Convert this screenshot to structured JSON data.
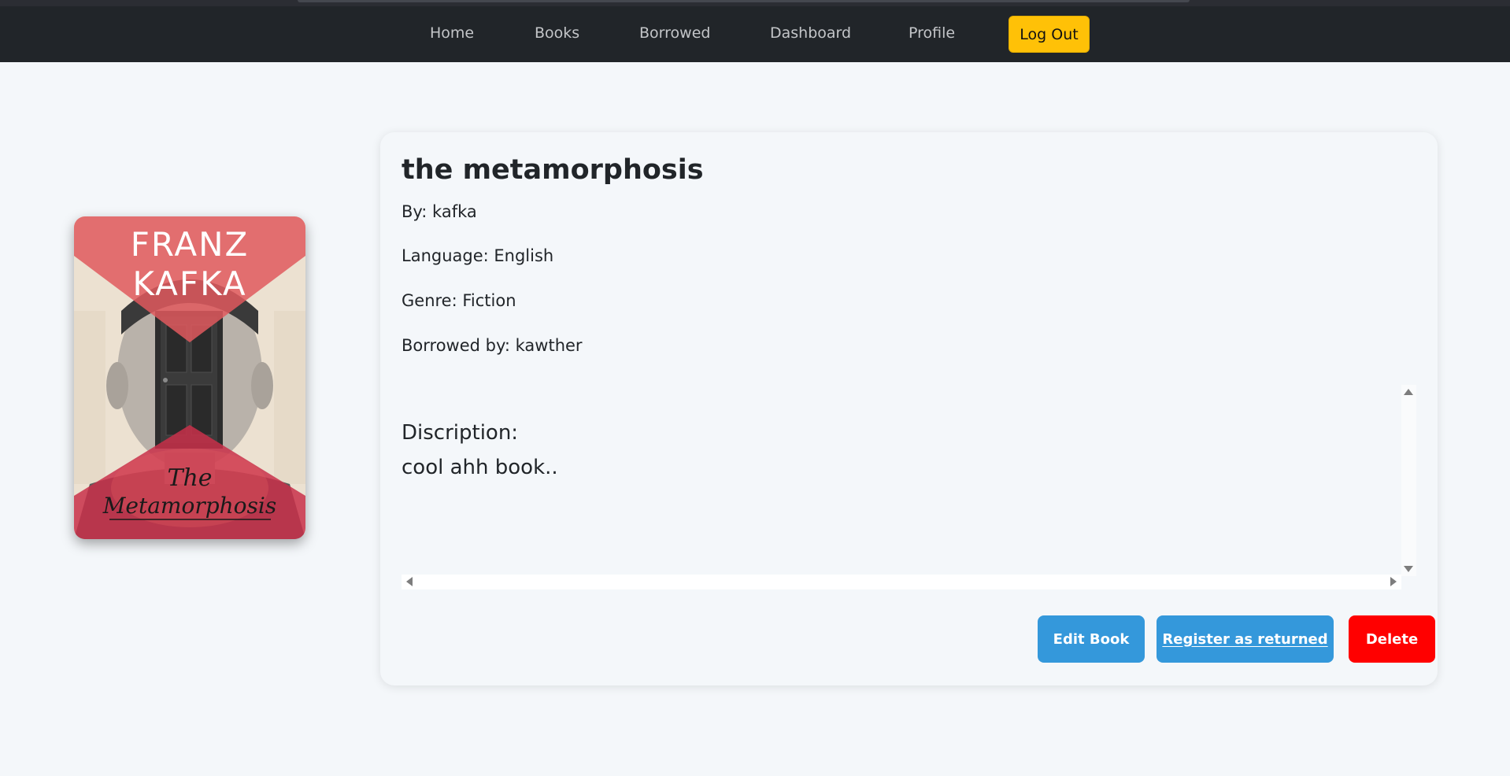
{
  "nav": {
    "items": [
      {
        "label": "Home"
      },
      {
        "label": "Books"
      },
      {
        "label": "Borrowed"
      },
      {
        "label": "Dashboard"
      },
      {
        "label": "Profile"
      }
    ],
    "logout_label": "Log Out"
  },
  "cover": {
    "author_line1": "FRANZ",
    "author_line2": "KAFKA",
    "title_line1": "The",
    "title_line2": "Metamorphosis"
  },
  "book": {
    "title": "the metamorphosis",
    "author": "By: kafka",
    "language": "Language: English",
    "genre": "Genre: Fiction",
    "borrowed_by": "Borrowed by: kawther",
    "description_heading": "Discription:",
    "description": "cool ahh book.."
  },
  "actions": {
    "edit_label": "Edit Book",
    "return_label": "Register as returned",
    "delete_label": "Delete"
  },
  "colors": {
    "navbar": "#212529",
    "logout": "#ffc107",
    "primary_button": "#3498db",
    "danger_button": "#ff0000",
    "page_background": "#f4f7fa"
  }
}
